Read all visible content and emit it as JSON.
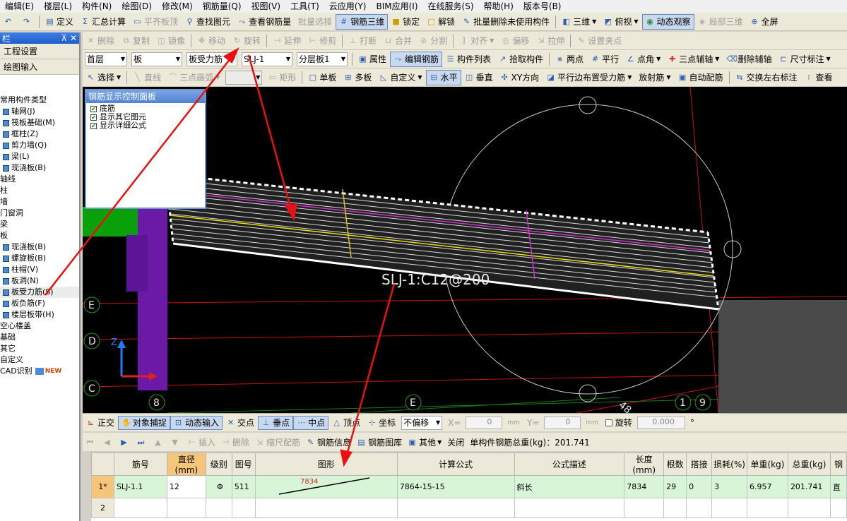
{
  "menu": [
    "编辑(E)",
    "楼层(L)",
    "构件(N)",
    "绘图(D)",
    "修改(M)",
    "钢筋量(Q)",
    "视图(V)",
    "工具(T)",
    "云应用(Y)",
    "BIM应用(I)",
    "在线服务(S)",
    "帮助(H)",
    "版本号(B)"
  ],
  "toolbar1": {
    "define": "定义",
    "sum": "汇总计算",
    "flat_top": "平齐板顶",
    "find": "查找图元",
    "view_rebar": "查看钢筋量",
    "batch_select": "批量选择",
    "rebar_3d": "钢筋三维",
    "lock": "锁定",
    "unlock": "解锁",
    "batch_delete": "批量删除未使用构件",
    "view3d": "三维",
    "top_view": "俯视",
    "dynamic_view": "动态观察",
    "local3d": "局部三维",
    "fullscreen": "全屏"
  },
  "toolbar2": {
    "delete": "删除",
    "copy": "复制",
    "mirror": "镜像",
    "move": "移动",
    "rotate": "旋转",
    "extend": "延伸",
    "trim": "修剪",
    "break": "打断",
    "merge": "合并",
    "split": "分割",
    "align": "对齐",
    "offset": "偏移",
    "stretch": "拉伸",
    "grip": "设置夹点"
  },
  "toolbar3": {
    "floor": "首层",
    "type": "板",
    "category": "板受力筋",
    "component": "SLJ-1",
    "layer": "分层板1",
    "props": "属性",
    "edit_rebar": "编辑钢筋",
    "list": "构件列表",
    "pick": "拾取构件",
    "two_points": "两点",
    "parallel": "平行",
    "point_angle": "点角",
    "three_point_aux": "三点辅轴",
    "delete_aux": "删除辅轴",
    "dim": "尺寸标注"
  },
  "toolbar4": {
    "select": "选择",
    "line": "直线",
    "arc3": "三点画弧",
    "rect": "矩形",
    "single": "单板",
    "multi": "多板",
    "custom": "自定义",
    "horizontal": "水平",
    "vertical": "垂直",
    "xy": "XY方向",
    "parallel_edge": "平行边布置受力筋",
    "radial": "放射筋",
    "auto": "自动配筋",
    "swap": "交换左右标注",
    "view": "查看"
  },
  "left_panel": {
    "title": "栏",
    "project_settings": "工程设置",
    "draw_input": "绘图输入",
    "tree": [
      "常用构件类型",
      "轴网(J)",
      "筏板基础(M)",
      "框柱(Z)",
      "剪力墙(Q)",
      "梁(L)",
      "现浇板(B)",
      "轴线",
      "柱",
      "墙",
      "门窗洞",
      "梁",
      "板",
      "现浇板(B)",
      "螺旋板(B)",
      "柱帽(V)",
      "板洞(N)",
      "板受力筋(S)",
      "板负筋(F)",
      "楼层板带(H)",
      "空心楼盖",
      "基础",
      "其它",
      "自定义",
      "CAD识别"
    ],
    "new_badge": "NEW"
  },
  "control_panel": {
    "title": "钢筋显示控制面板",
    "items": [
      "底筋",
      "显示其它图元",
      "显示详细公式"
    ]
  },
  "canvas": {
    "label": "SLJ-1:C12@200",
    "axis_labels": [
      "E",
      "D",
      "C",
      "8",
      "E",
      "1",
      "9",
      "48"
    ],
    "z_label": "Z"
  },
  "status_bar": {
    "ortho": "正交",
    "snap": "对象捕捉",
    "dyn_input": "动态输入",
    "intersect": "交点",
    "perp": "垂点",
    "mid": "中点",
    "vertex": "顶点",
    "coord": "坐标",
    "offset_mode": "不偏移",
    "x_label": "X=",
    "x_val": "0",
    "y_label": "Y=",
    "y_val": "0",
    "unit": "mm",
    "rotate": "旋转",
    "rotate_val": "0.000",
    "deg": "°"
  },
  "grid_toolbar": {
    "insert": "插入",
    "delete": "删除",
    "scale": "缩尺配筋",
    "info": "钢筋信息",
    "library": "钢筋图库",
    "other": "其他",
    "close": "关闭",
    "total": "单构件钢筋总重(kg)：201.741"
  },
  "table": {
    "headers": [
      "",
      "筋号",
      "直径(mm)",
      "级别",
      "图号",
      "图形",
      "计算公式",
      "公式描述",
      "长度(mm)",
      "根数",
      "搭接",
      "损耗(%)",
      "单重(kg)",
      "总重(kg)",
      "钢"
    ],
    "rows": [
      {
        "n": "1*",
        "name": "SLJ-1.1",
        "dia": "12",
        "grade": "Φ",
        "fig": "511",
        "shape_len": "7834",
        "formula": "7864-15-15",
        "desc": "斜长",
        "len": "7834",
        "count": "29",
        "lap": "0",
        "loss": "3",
        "unit_w": "6.957",
        "total_w": "201.741",
        "steel": "直"
      },
      {
        "n": "2",
        "name": "",
        "dia": "",
        "grade": "",
        "fig": "",
        "shape_len": "",
        "formula": "",
        "desc": "",
        "len": "",
        "count": "",
        "lap": "",
        "loss": "",
        "unit_w": "",
        "total_w": "",
        "steel": ""
      }
    ]
  }
}
